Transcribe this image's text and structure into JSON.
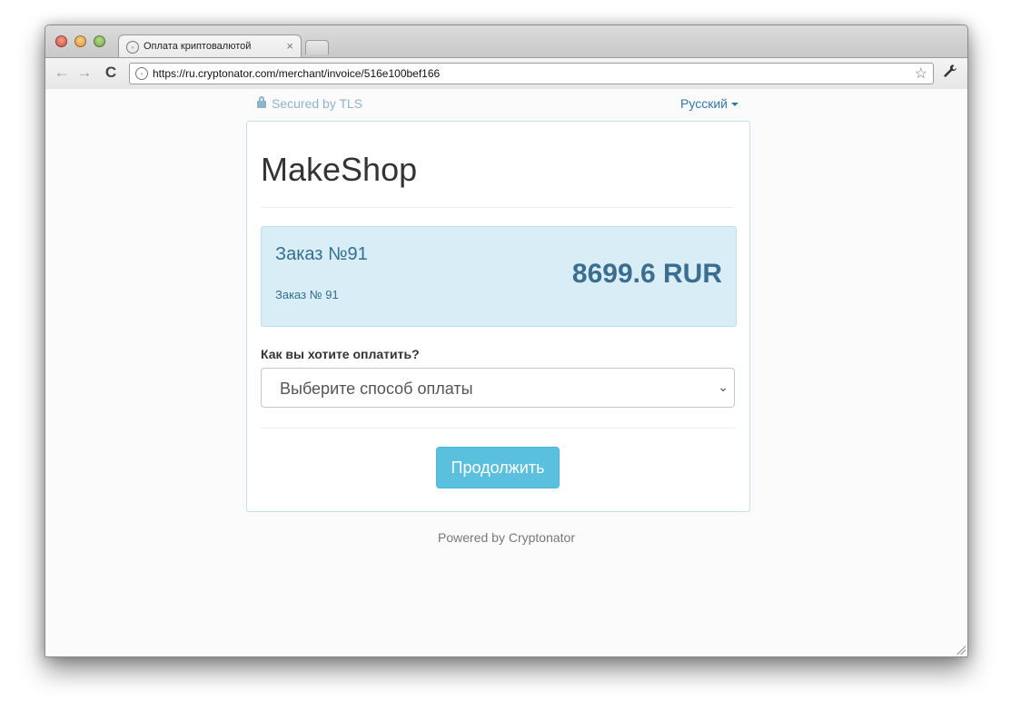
{
  "browser": {
    "tab_title": "Оплата криптовалютой",
    "tab_close": "×",
    "url": "https://ru.cryptonator.com/merchant/invoice/516e100bef166",
    "icons": {
      "back": "←",
      "forward": "→",
      "reload": "C",
      "star": "☆",
      "wrench": "🔧"
    }
  },
  "page": {
    "secured_label": "Secured by TLS",
    "language_label": "Русский",
    "shop_name": "MakeShop",
    "order_title": "Заказ №91",
    "order_description": "Заказ № 91",
    "amount": "8699.6 RUR",
    "payment_question": "Как вы хотите оплатить?",
    "payment_select_placeholder": "Выберите способ оплаты",
    "continue_label": "Продолжить",
    "footer": "Powered by Cryptonator"
  },
  "colors": {
    "accent_button": "#5bc0de",
    "order_box_bg": "#d9edf6",
    "order_text": "#31708f",
    "link": "#2f79a8"
  }
}
